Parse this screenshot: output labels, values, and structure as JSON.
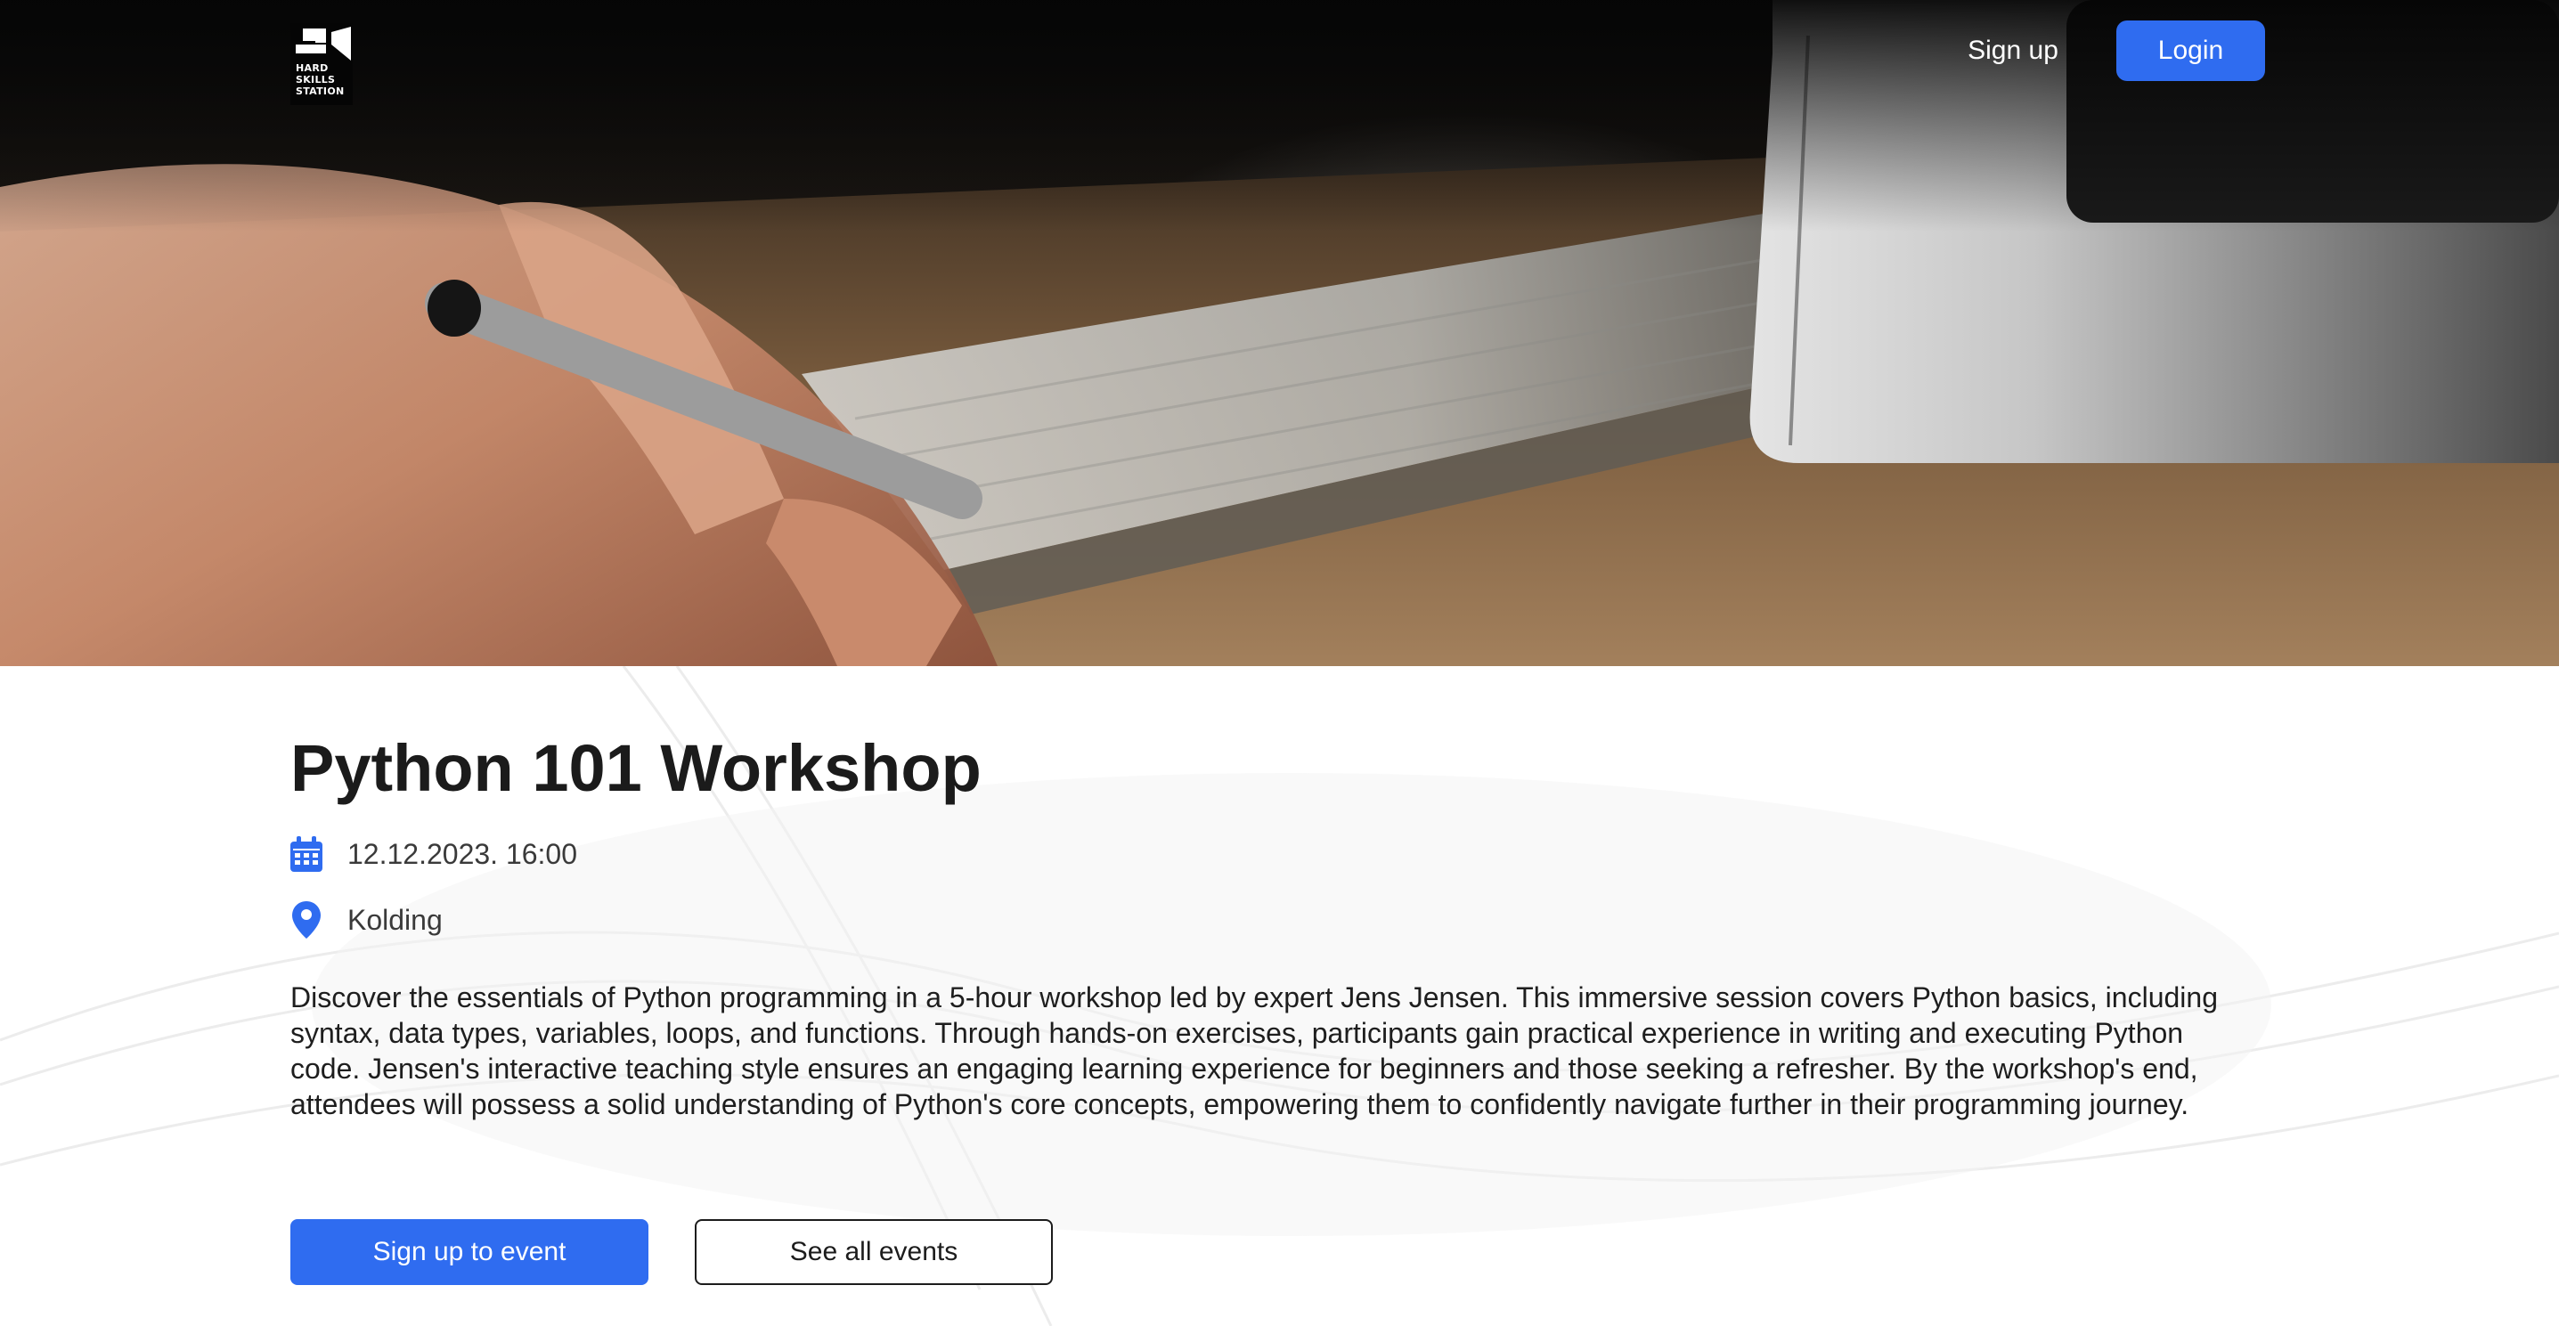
{
  "brand": {
    "logo_text": "HARD\nSKILLS\nSTATION"
  },
  "nav": {
    "signup_label": "Sign up",
    "login_label": "Login"
  },
  "event": {
    "title": "Python 101 Workshop",
    "datetime": "12.12.2023. 16:00",
    "location": "Kolding",
    "description": "Discover the essentials of Python programming in a 5-hour workshop led by expert Jens Jensen. This immersive session covers Python basics, including syntax, data types, variables, loops, and functions. Through hands-on exercises, participants gain practical experience in writing and executing Python code. Jensen's interactive teaching style ensures an engaging learning experience for beginners and those seeking a refresher. By the workshop's end, attendees will possess a solid understanding of Python's core concepts, empowering them to confidently navigate further in their programming journey."
  },
  "actions": {
    "signup_event_label": "Sign up to event",
    "see_all_label": "See all events"
  },
  "icons": {
    "date": "calendar-icon",
    "location": "map-pin-icon"
  },
  "colors": {
    "accent": "#2f6cf0",
    "text": "#1c1c1c",
    "background": "#ffffff"
  }
}
